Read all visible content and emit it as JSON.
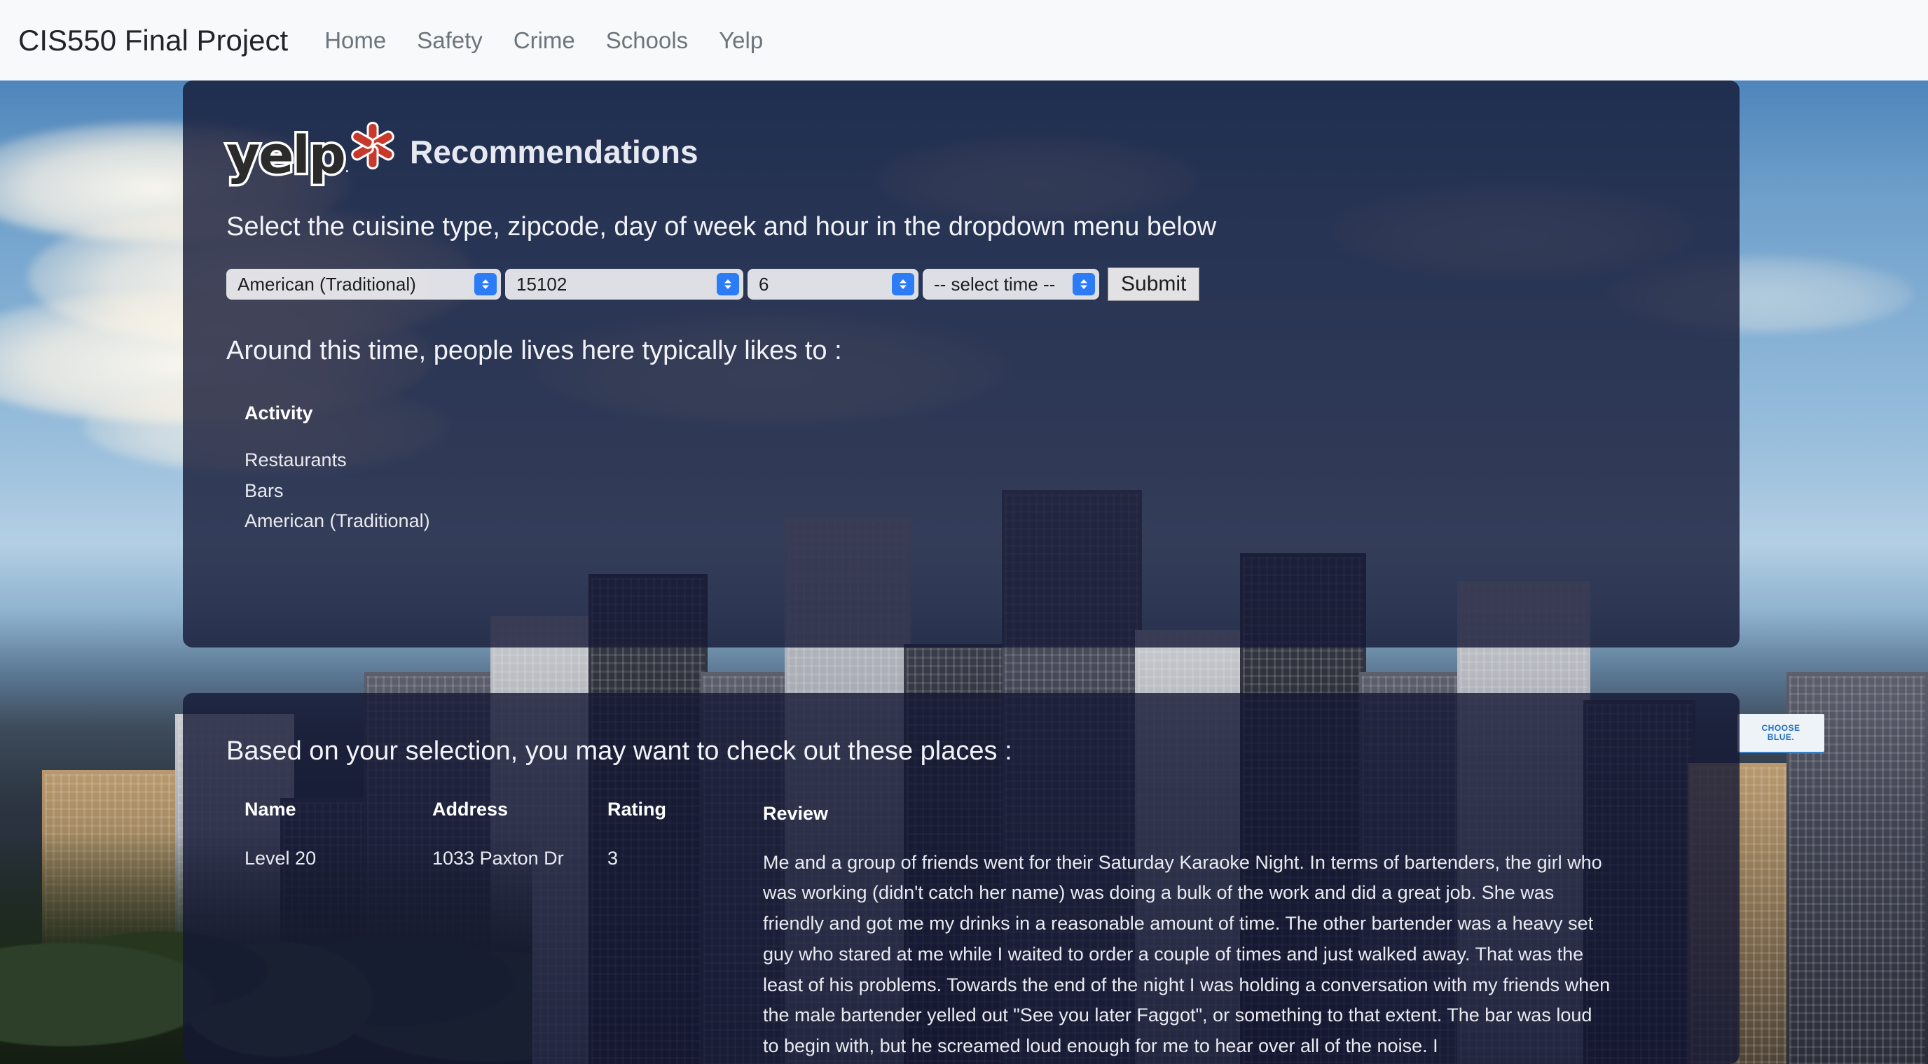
{
  "navbar": {
    "brand": "CIS550 Final Project",
    "links": [
      {
        "label": "Home"
      },
      {
        "label": "Safety"
      },
      {
        "label": "Crime"
      },
      {
        "label": "Schools"
      },
      {
        "label": "Yelp"
      }
    ]
  },
  "hero": {
    "logo_word": "yelp",
    "logo_dot": ".",
    "title": "Recommendations",
    "instruction": "Select the cuisine type, zipcode, day of week and hour in the dropdown menu below"
  },
  "controls": {
    "cuisine": {
      "value": "American (Traditional)"
    },
    "zipcode": {
      "value": "15102"
    },
    "day": {
      "value": "6"
    },
    "time": {
      "value": "-- select time --"
    },
    "submit_label": "Submit"
  },
  "activity_section": {
    "heading": "Around this time, people lives here typically likes to :",
    "column_header": "Activity",
    "items": [
      "Restaurants",
      "Bars",
      "American (Traditional)"
    ]
  },
  "places_section": {
    "heading": "Based on your selection, you may want to check out these places :",
    "columns": {
      "name": "Name",
      "address": "Address",
      "rating": "Rating",
      "review": "Review"
    },
    "rows": [
      {
        "name": "Level 20",
        "address": "1033 Paxton Dr",
        "rating": "3",
        "review": "Me and a group of friends went for their Saturday Karaoke Night. In terms of bartenders, the girl who was working (didn't catch her name) was doing a bulk of the work and did a great job. She was friendly and got me my drinks in a reasonable amount of time. The other bartender was a heavy set guy who stared at me while I waited to order a couple of times and just walked away. That was the least of his problems. Towards the end of the night I was holding a conversation with my friends when the male bartender yelled out \"See you later Faggot\", or something to that extent. The bar was loud to begin with, but he screamed loud enough for me to hear over all of the noise. I"
      }
    ]
  },
  "background": {
    "billboard_line1": "CHOOSE",
    "billboard_line2": "BLUE."
  },
  "colors": {
    "navbar_bg": "#f8f9fa",
    "nav_link": "#6c757d",
    "panel_overlay": "rgba(20,24,52,0.80)",
    "stepper_blue": "#2b7cf6",
    "yelp_red": "#c8392b"
  }
}
